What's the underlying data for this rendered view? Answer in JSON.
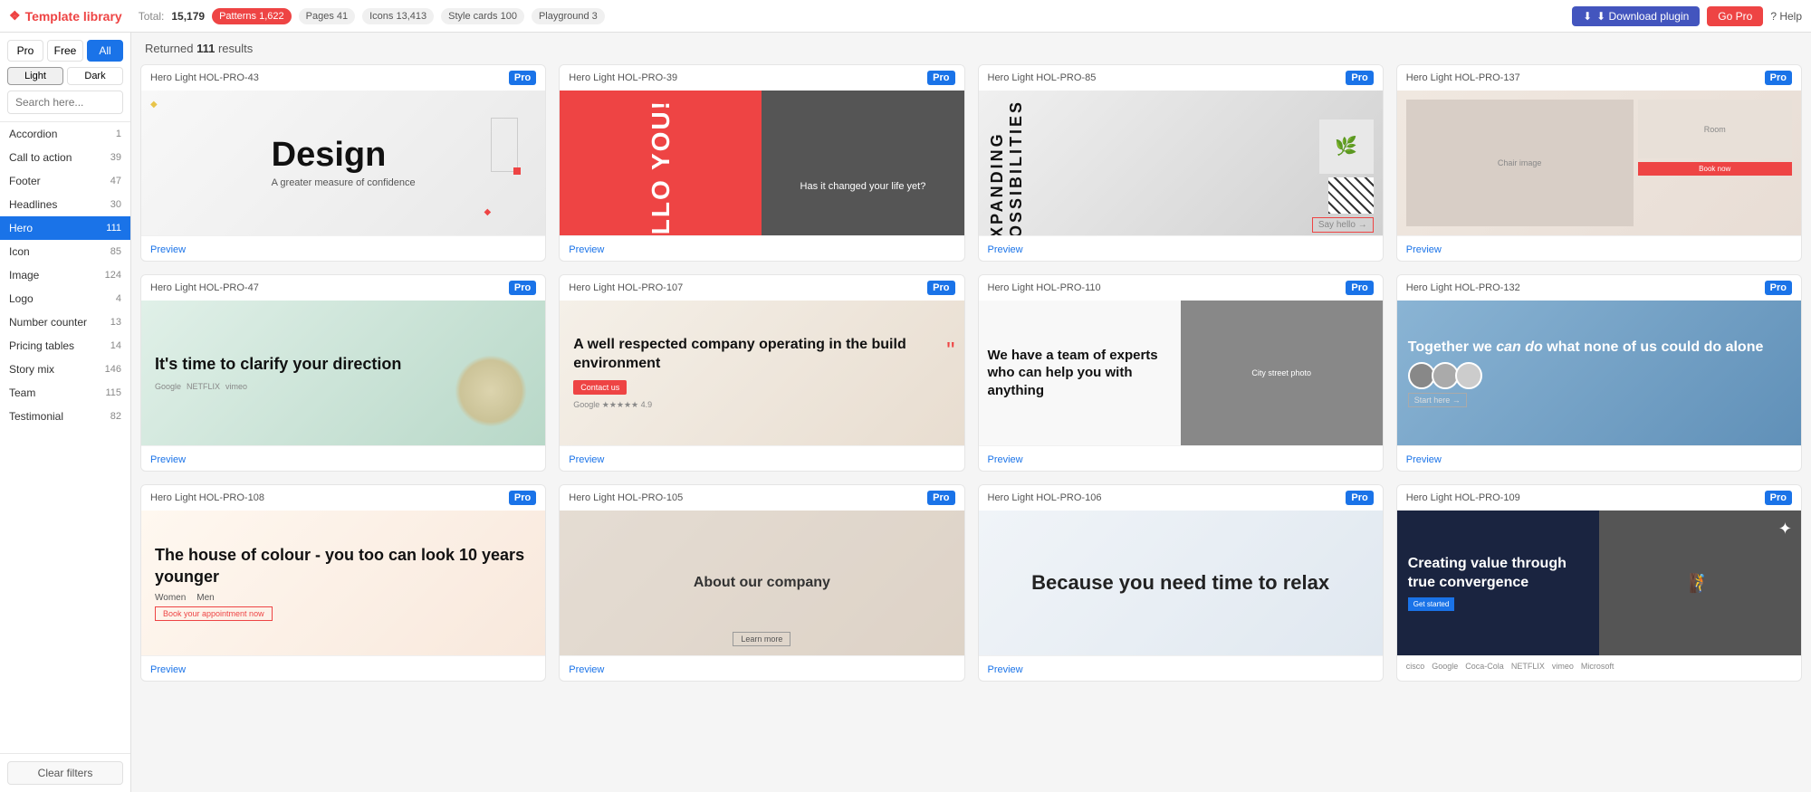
{
  "brand": {
    "name": "Template library",
    "icon": "❖"
  },
  "topnav": {
    "total_label": "Total:",
    "total_count": "15,179",
    "tabs": [
      {
        "id": "patterns",
        "label": "Patterns",
        "count": "1,622",
        "active": true
      },
      {
        "id": "pages",
        "label": "Pages",
        "count": "41"
      },
      {
        "id": "icons",
        "label": "Icons",
        "count": "13,413"
      },
      {
        "id": "style_cards",
        "label": "Style cards",
        "count": "100"
      },
      {
        "id": "playground",
        "label": "Playground",
        "count": "3"
      }
    ],
    "download_plugin": "⬇ Download plugin",
    "go_pro": "Go Pro",
    "help": "? Help"
  },
  "sidebar": {
    "filter_pro": "Pro",
    "filter_free": "Free",
    "filter_all": "All",
    "theme_light": "Light",
    "theme_dark": "Dark",
    "search_placeholder": "Search here...",
    "items": [
      {
        "label": "Accordion",
        "count": "1"
      },
      {
        "label": "Call to action",
        "count": "39",
        "active": true
      },
      {
        "label": "Footer",
        "count": "47"
      },
      {
        "label": "Headlines",
        "count": "30"
      },
      {
        "label": "Hero",
        "count": "111",
        "selected": true
      },
      {
        "label": "Icon",
        "count": "85"
      },
      {
        "label": "Image",
        "count": "124"
      },
      {
        "label": "Logo",
        "count": "4"
      },
      {
        "label": "Number counter",
        "count": "13"
      },
      {
        "label": "Pricing tables",
        "count": "14"
      },
      {
        "label": "Story mix",
        "count": "146"
      },
      {
        "label": "Team",
        "count": "115"
      },
      {
        "label": "Testimonial",
        "count": "82"
      }
    ],
    "clear_filters": "Clear filters"
  },
  "results": {
    "returned_label": "Returned",
    "count": "111",
    "suffix": "results"
  },
  "cards": [
    {
      "id": "HOL-PRO-43",
      "title": "Hero Light HOL-PRO-43",
      "badge": "Pro",
      "bg": "design",
      "text": "Design\nA greater measure of confidence",
      "preview_label": "Preview"
    },
    {
      "id": "HOL-PRO-39",
      "title": "Hero Light HOL-PRO-39",
      "badge": "Pro",
      "bg": "hello",
      "text": "HELLO YOU!\nHas it changed your life yet?",
      "preview_label": "Preview"
    },
    {
      "id": "HOL-PRO-85",
      "title": "Hero Light HOL-PRO-85",
      "badge": "Pro",
      "bg": "expand",
      "text": "EXPANDING POSSIBILITIES",
      "preview_label": "Preview"
    },
    {
      "id": "HOL-PRO-137",
      "title": "Hero Light HOL-PRO-137",
      "badge": "Pro",
      "bg": "room",
      "text": "",
      "preview_label": "Preview"
    },
    {
      "id": "HOL-PRO-47",
      "title": "Hero Light HOL-PRO-47",
      "badge": "Pro",
      "bg": "clarify",
      "text": "It's time to clarify your direction",
      "preview_label": "Preview"
    },
    {
      "id": "HOL-PRO-107",
      "title": "Hero Light HOL-PRO-107",
      "badge": "Pro",
      "bg": "company",
      "text": "A well respected company operating in the build environment",
      "preview_label": "Preview"
    },
    {
      "id": "HOL-PRO-110",
      "title": "Hero Light HOL-PRO-110",
      "badge": "Pro",
      "bg": "team",
      "text": "We have a team of experts who can help you with anything",
      "preview_label": "Preview"
    },
    {
      "id": "HOL-PRO-132",
      "title": "Hero Light HOL-PRO-132",
      "badge": "Pro",
      "bg": "together",
      "text": "Together we can do what none of us could do alone",
      "preview_label": "Preview"
    },
    {
      "id": "HOL-PRO-108",
      "title": "Hero Light HOL-PRO-108",
      "badge": "Pro",
      "bg": "colour",
      "text": "The house of colour - you too can look 10 years younger",
      "preview_label": "Preview"
    },
    {
      "id": "HOL-PRO-105",
      "title": "Hero Light HOL-PRO-105",
      "badge": "Pro",
      "bg": "company2",
      "text": "About our company",
      "preview_label": "Preview"
    },
    {
      "id": "HOL-PRO-106",
      "title": "Hero Light HOL-PRO-106",
      "badge": "Pro",
      "bg": "relax",
      "text": "Because you need time to relax",
      "preview_label": "Preview"
    },
    {
      "id": "HOL-PRO-109",
      "title": "Hero Light HOL-PRO-109",
      "badge": "Pro",
      "bg": "converge",
      "text": "Creating value through true convergence",
      "preview_label": "Preview"
    }
  ]
}
